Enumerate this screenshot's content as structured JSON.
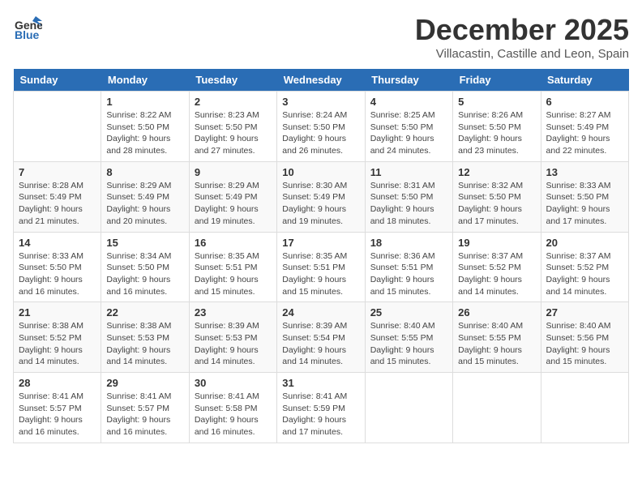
{
  "logo": {
    "general": "General",
    "blue": "Blue"
  },
  "title": "December 2025",
  "location": "Villacastin, Castille and Leon, Spain",
  "days_header": [
    "Sunday",
    "Monday",
    "Tuesday",
    "Wednesday",
    "Thursday",
    "Friday",
    "Saturday"
  ],
  "weeks": [
    [
      {
        "day": "",
        "sunrise": "",
        "sunset": "",
        "daylight": ""
      },
      {
        "day": "1",
        "sunrise": "Sunrise: 8:22 AM",
        "sunset": "Sunset: 5:50 PM",
        "daylight": "Daylight: 9 hours and 28 minutes."
      },
      {
        "day": "2",
        "sunrise": "Sunrise: 8:23 AM",
        "sunset": "Sunset: 5:50 PM",
        "daylight": "Daylight: 9 hours and 27 minutes."
      },
      {
        "day": "3",
        "sunrise": "Sunrise: 8:24 AM",
        "sunset": "Sunset: 5:50 PM",
        "daylight": "Daylight: 9 hours and 26 minutes."
      },
      {
        "day": "4",
        "sunrise": "Sunrise: 8:25 AM",
        "sunset": "Sunset: 5:50 PM",
        "daylight": "Daylight: 9 hours and 24 minutes."
      },
      {
        "day": "5",
        "sunrise": "Sunrise: 8:26 AM",
        "sunset": "Sunset: 5:50 PM",
        "daylight": "Daylight: 9 hours and 23 minutes."
      },
      {
        "day": "6",
        "sunrise": "Sunrise: 8:27 AM",
        "sunset": "Sunset: 5:49 PM",
        "daylight": "Daylight: 9 hours and 22 minutes."
      }
    ],
    [
      {
        "day": "7",
        "sunrise": "Sunrise: 8:28 AM",
        "sunset": "Sunset: 5:49 PM",
        "daylight": "Daylight: 9 hours and 21 minutes."
      },
      {
        "day": "8",
        "sunrise": "Sunrise: 8:29 AM",
        "sunset": "Sunset: 5:49 PM",
        "daylight": "Daylight: 9 hours and 20 minutes."
      },
      {
        "day": "9",
        "sunrise": "Sunrise: 8:29 AM",
        "sunset": "Sunset: 5:49 PM",
        "daylight": "Daylight: 9 hours and 19 minutes."
      },
      {
        "day": "10",
        "sunrise": "Sunrise: 8:30 AM",
        "sunset": "Sunset: 5:49 PM",
        "daylight": "Daylight: 9 hours and 19 minutes."
      },
      {
        "day": "11",
        "sunrise": "Sunrise: 8:31 AM",
        "sunset": "Sunset: 5:50 PM",
        "daylight": "Daylight: 9 hours and 18 minutes."
      },
      {
        "day": "12",
        "sunrise": "Sunrise: 8:32 AM",
        "sunset": "Sunset: 5:50 PM",
        "daylight": "Daylight: 9 hours and 17 minutes."
      },
      {
        "day": "13",
        "sunrise": "Sunrise: 8:33 AM",
        "sunset": "Sunset: 5:50 PM",
        "daylight": "Daylight: 9 hours and 17 minutes."
      }
    ],
    [
      {
        "day": "14",
        "sunrise": "Sunrise: 8:33 AM",
        "sunset": "Sunset: 5:50 PM",
        "daylight": "Daylight: 9 hours and 16 minutes."
      },
      {
        "day": "15",
        "sunrise": "Sunrise: 8:34 AM",
        "sunset": "Sunset: 5:50 PM",
        "daylight": "Daylight: 9 hours and 16 minutes."
      },
      {
        "day": "16",
        "sunrise": "Sunrise: 8:35 AM",
        "sunset": "Sunset: 5:51 PM",
        "daylight": "Daylight: 9 hours and 15 minutes."
      },
      {
        "day": "17",
        "sunrise": "Sunrise: 8:35 AM",
        "sunset": "Sunset: 5:51 PM",
        "daylight": "Daylight: 9 hours and 15 minutes."
      },
      {
        "day": "18",
        "sunrise": "Sunrise: 8:36 AM",
        "sunset": "Sunset: 5:51 PM",
        "daylight": "Daylight: 9 hours and 15 minutes."
      },
      {
        "day": "19",
        "sunrise": "Sunrise: 8:37 AM",
        "sunset": "Sunset: 5:52 PM",
        "daylight": "Daylight: 9 hours and 14 minutes."
      },
      {
        "day": "20",
        "sunrise": "Sunrise: 8:37 AM",
        "sunset": "Sunset: 5:52 PM",
        "daylight": "Daylight: 9 hours and 14 minutes."
      }
    ],
    [
      {
        "day": "21",
        "sunrise": "Sunrise: 8:38 AM",
        "sunset": "Sunset: 5:52 PM",
        "daylight": "Daylight: 9 hours and 14 minutes."
      },
      {
        "day": "22",
        "sunrise": "Sunrise: 8:38 AM",
        "sunset": "Sunset: 5:53 PM",
        "daylight": "Daylight: 9 hours and 14 minutes."
      },
      {
        "day": "23",
        "sunrise": "Sunrise: 8:39 AM",
        "sunset": "Sunset: 5:53 PM",
        "daylight": "Daylight: 9 hours and 14 minutes."
      },
      {
        "day": "24",
        "sunrise": "Sunrise: 8:39 AM",
        "sunset": "Sunset: 5:54 PM",
        "daylight": "Daylight: 9 hours and 14 minutes."
      },
      {
        "day": "25",
        "sunrise": "Sunrise: 8:40 AM",
        "sunset": "Sunset: 5:55 PM",
        "daylight": "Daylight: 9 hours and 15 minutes."
      },
      {
        "day": "26",
        "sunrise": "Sunrise: 8:40 AM",
        "sunset": "Sunset: 5:55 PM",
        "daylight": "Daylight: 9 hours and 15 minutes."
      },
      {
        "day": "27",
        "sunrise": "Sunrise: 8:40 AM",
        "sunset": "Sunset: 5:56 PM",
        "daylight": "Daylight: 9 hours and 15 minutes."
      }
    ],
    [
      {
        "day": "28",
        "sunrise": "Sunrise: 8:41 AM",
        "sunset": "Sunset: 5:57 PM",
        "daylight": "Daylight: 9 hours and 16 minutes."
      },
      {
        "day": "29",
        "sunrise": "Sunrise: 8:41 AM",
        "sunset": "Sunset: 5:57 PM",
        "daylight": "Daylight: 9 hours and 16 minutes."
      },
      {
        "day": "30",
        "sunrise": "Sunrise: 8:41 AM",
        "sunset": "Sunset: 5:58 PM",
        "daylight": "Daylight: 9 hours and 16 minutes."
      },
      {
        "day": "31",
        "sunrise": "Sunrise: 8:41 AM",
        "sunset": "Sunset: 5:59 PM",
        "daylight": "Daylight: 9 hours and 17 minutes."
      },
      {
        "day": "",
        "sunrise": "",
        "sunset": "",
        "daylight": ""
      },
      {
        "day": "",
        "sunrise": "",
        "sunset": "",
        "daylight": ""
      },
      {
        "day": "",
        "sunrise": "",
        "sunset": "",
        "daylight": ""
      }
    ]
  ]
}
